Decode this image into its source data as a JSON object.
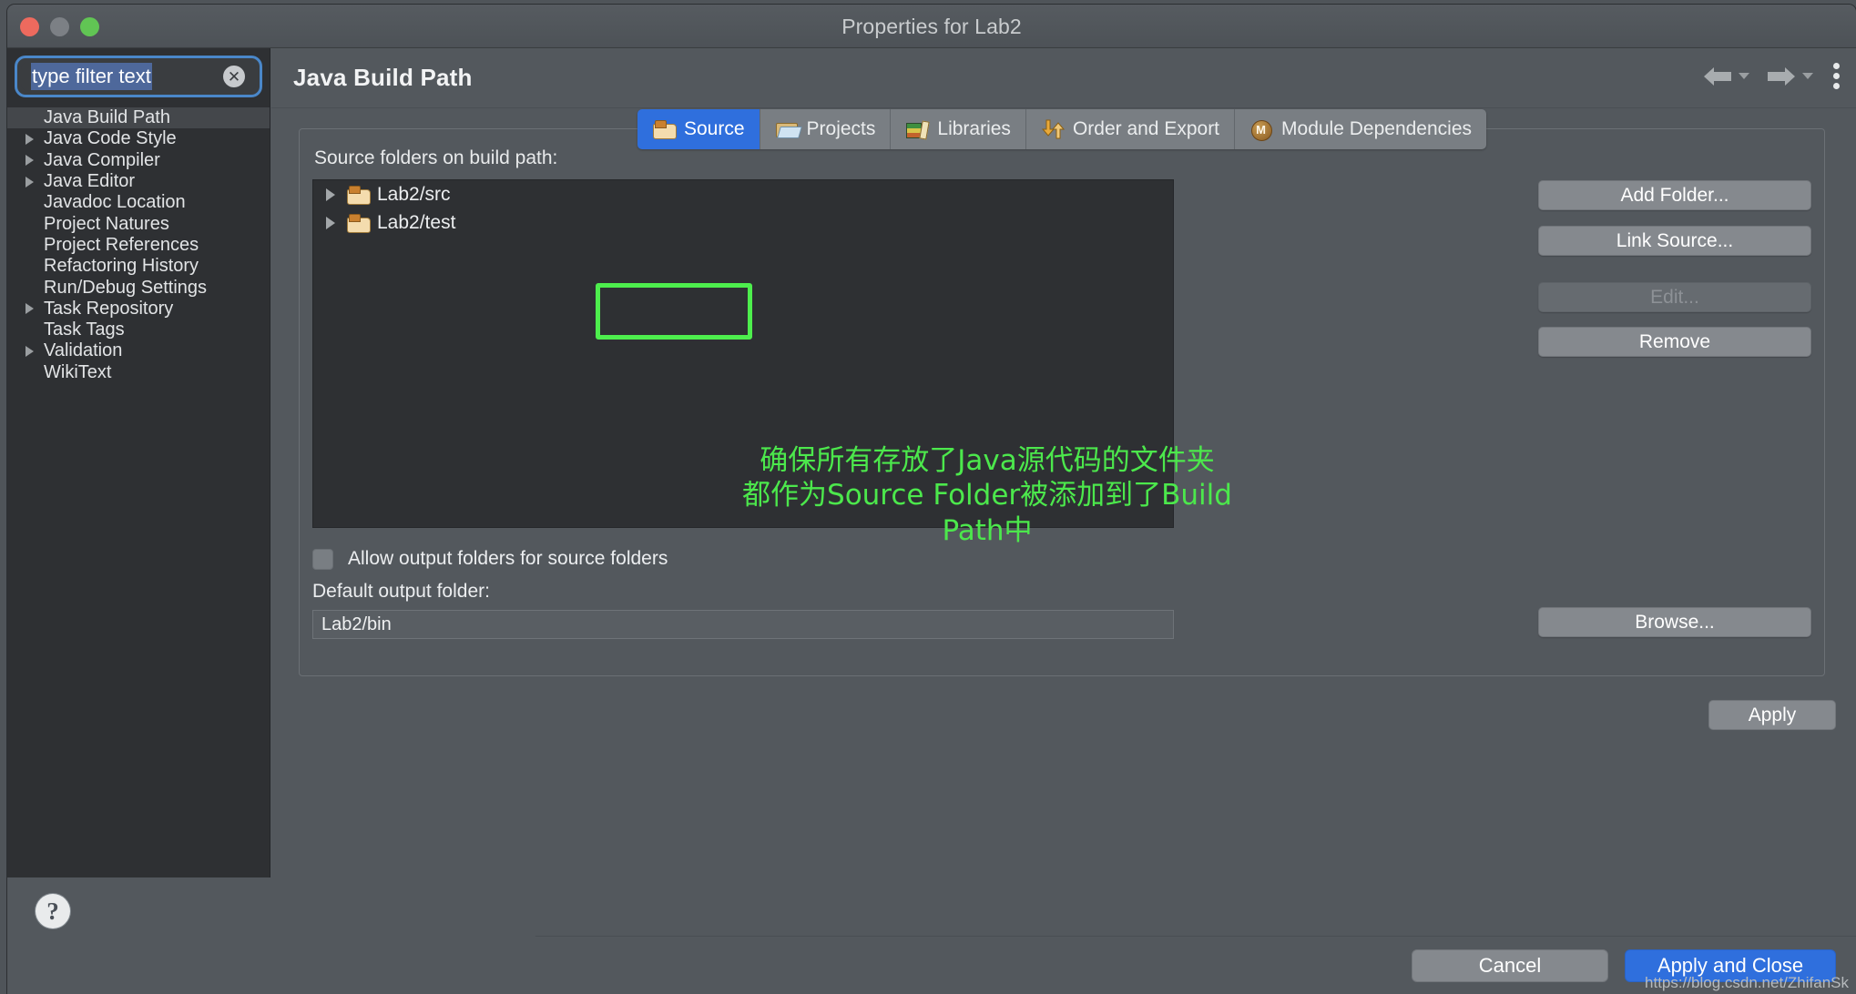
{
  "window": {
    "title": "Properties for Lab2",
    "traffic_lights": [
      "close-button",
      "minimize-button",
      "zoom-button"
    ]
  },
  "filter": {
    "value": "type filter text",
    "placeholder": "type filter text",
    "clear_glyph": "✕"
  },
  "sidebar": {
    "items": [
      {
        "label": "Java Build Path",
        "expandable": false,
        "selected": true
      },
      {
        "label": "Java Code Style",
        "expandable": true,
        "selected": false
      },
      {
        "label": "Java Compiler",
        "expandable": true,
        "selected": false
      },
      {
        "label": "Java Editor",
        "expandable": true,
        "selected": false
      },
      {
        "label": "Javadoc Location",
        "expandable": false,
        "selected": false
      },
      {
        "label": "Project Natures",
        "expandable": false,
        "selected": false
      },
      {
        "label": "Project References",
        "expandable": false,
        "selected": false
      },
      {
        "label": "Refactoring History",
        "expandable": false,
        "selected": false
      },
      {
        "label": "Run/Debug Settings",
        "expandable": false,
        "selected": false
      },
      {
        "label": "Task Repository",
        "expandable": true,
        "selected": false
      },
      {
        "label": "Task Tags",
        "expandable": false,
        "selected": false
      },
      {
        "label": "Validation",
        "expandable": true,
        "selected": false
      },
      {
        "label": "WikiText",
        "expandable": false,
        "selected": false
      }
    ],
    "help_glyph": "?"
  },
  "page": {
    "title": "Java Build Path",
    "nav": {
      "back": "back-arrow",
      "back_menu": "back-dropdown",
      "forward": "forward-arrow",
      "forward_menu": "forward-dropdown",
      "menu": "view-menu"
    }
  },
  "tabs": [
    {
      "label": "Source",
      "icon": "java-source-folder-icon",
      "active": true
    },
    {
      "label": "Projects",
      "icon": "open-folder-icon",
      "active": false
    },
    {
      "label": "Libraries",
      "icon": "books-icon",
      "active": false
    },
    {
      "label": "Order and Export",
      "icon": "up-down-arrows-icon",
      "active": false
    },
    {
      "label": "Module Dependencies",
      "icon": "module-m-icon",
      "active": false
    }
  ],
  "source_tab": {
    "list_label": "Source folders on build path:",
    "folders": [
      {
        "name": "Lab2/src",
        "icon": "java-source-folder-icon"
      },
      {
        "name": "Lab2/test",
        "icon": "java-source-folder-icon"
      }
    ],
    "buttons": [
      {
        "label": "Add Folder...",
        "enabled": true
      },
      {
        "label": "Link Source...",
        "enabled": true
      },
      {
        "label": "Edit...",
        "enabled": false
      },
      {
        "label": "Remove",
        "enabled": true
      }
    ],
    "allow_output_label": "Allow output folders for source folders",
    "allow_output_checked": false,
    "default_output_label": "Default output folder:",
    "default_output_value": "Lab2/bin",
    "browse_label": "Browse...",
    "apply_label": "Apply"
  },
  "annotation": {
    "line1": "确保所有存放了Java源代码的文件夹",
    "line2": "都作为Source Folder被添加到了Build Path中",
    "color": "#4ce84c",
    "highlight_target": "source-folders-list"
  },
  "footer": {
    "cancel_label": "Cancel",
    "apply_and_close_label": "Apply and Close",
    "watermark": "https://blog.csdn.net/ZhifanSk"
  },
  "colors": {
    "accent_blue": "#2f6fdd",
    "annotation_green": "#4ce84c",
    "window_bg": "#53585d",
    "panel_dark": "#2e3033"
  }
}
